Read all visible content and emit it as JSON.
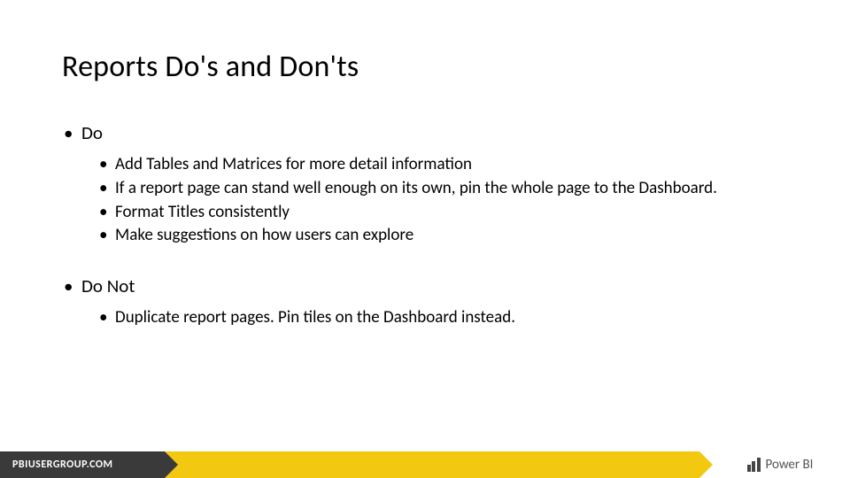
{
  "title": "Reports Do's and Don'ts",
  "sections": [
    {
      "heading": "Do",
      "items": [
        "Add Tables and Matrices for more detail information",
        "If a report page can stand well enough on its own, pin the whole page to the Dashboard.",
        "Format Titles consistently",
        "Make suggestions on how users can explore"
      ]
    },
    {
      "heading": "Do Not",
      "items": [
        "Duplicate report pages.  Pin tiles on the Dashboard instead."
      ]
    }
  ],
  "footer": {
    "left": "PBIUSERGROUP.COM",
    "brand": "Power BI"
  }
}
